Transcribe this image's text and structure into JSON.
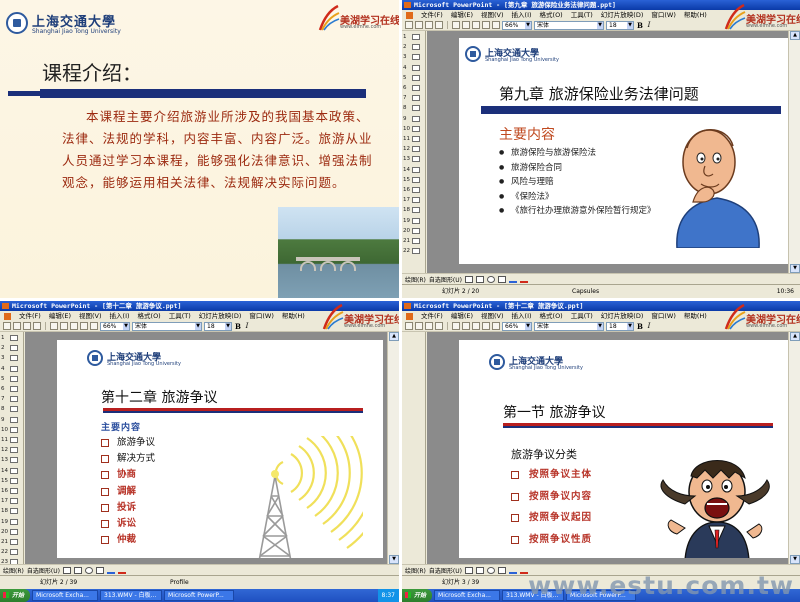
{
  "logos": {
    "sjtu_cn": "上海交通大學",
    "sjtu_en": "Shanghai Jiao Tong University",
    "meihu_name": "美湖学习在线",
    "meihu_url": "www.eimhe.com"
  },
  "q1": {
    "title": "课程介绍：",
    "body": "本课程主要介绍旅游业所涉及的我国基本政策、法律、法规的学科，内容丰富、内容广泛。旅游从业人员通过学习本课程，能够强化法律意识、增强法制观念，能够运用相关法律、法规解决实际问题。"
  },
  "ppt_menu": [
    "文件(F)",
    "编辑(E)",
    "视图(V)",
    "插入(I)",
    "格式(O)",
    "工具(T)",
    "幻灯片放映(D)",
    "窗口(W)",
    "帮助(H)"
  ],
  "toolbar": {
    "zoom": "66%",
    "font": "宋体",
    "size": "18",
    "bold": "B",
    "italic": "I"
  },
  "drawbar": {
    "draw": "绘图(R)",
    "autoshape": "自选图形(U)"
  },
  "q2": {
    "window_title": "Microsoft PowerPoint - [第九章 旅游保险业务法律问题.ppt]",
    "outline_numbers": [
      "1",
      "2",
      "3",
      "4",
      "5",
      "6",
      "7",
      "8",
      "9",
      "10",
      "11",
      "12",
      "13",
      "14",
      "15",
      "16",
      "17",
      "18",
      "19",
      "20",
      "21",
      "22"
    ],
    "slide_title": "第九章 旅游保险业务法律问题",
    "subtitle": "主要内容",
    "items": [
      "旅游保险与旅游保险法",
      "旅游保险合同",
      "风险与理赔",
      "《保险法》",
      "《旅行社办理旅游意外保险暂行规定》"
    ],
    "status_left": "幻灯片 2 / 20",
    "status_mid": "Capsules",
    "clock": "10:36"
  },
  "q3": {
    "window_title": "Microsoft PowerPoint - [第十二章 旅游争议.ppt]",
    "outline_numbers": [
      "1",
      "2",
      "3",
      "4",
      "5",
      "6",
      "7",
      "8",
      "9",
      "10",
      "11",
      "12",
      "13",
      "14",
      "15",
      "16",
      "17",
      "18",
      "19",
      "20",
      "21",
      "22",
      "23"
    ],
    "slide_title": "第十二章 旅游争议",
    "tag": "主要内容",
    "items": [
      "旅游争议",
      "解决方式",
      "协商",
      "调解",
      "投诉",
      "诉讼",
      "仲裁"
    ],
    "status_left": "幻灯片 2 / 39",
    "status_mid": "Profile",
    "clock": "8:37",
    "taskbar": [
      "开始",
      "Microsoft Excha...",
      "313.WMV - 白板...",
      "Microsoft PowerP..."
    ]
  },
  "q4": {
    "window_title": "Microsoft PowerPoint - [第十二章 旅游争议.ppt]",
    "slide_title": "第一节 旅游争议",
    "subtitle": "旅游争议分类",
    "items": [
      "按照争议主体",
      "按照争议内容",
      "按照争议起因",
      "按照争议性质"
    ],
    "status_left": "幻灯片 3 / 39",
    "taskbar": [
      "开始",
      "Microsoft Excha...",
      "313.WMV - 白板...",
      "Microsoft PowerP..."
    ],
    "watermark": "www.estu.com.tw"
  },
  "colors": {
    "title_blue": "#1b2f7a",
    "accent_red": "#b8352a",
    "window_blue": "#0a3aa8"
  }
}
